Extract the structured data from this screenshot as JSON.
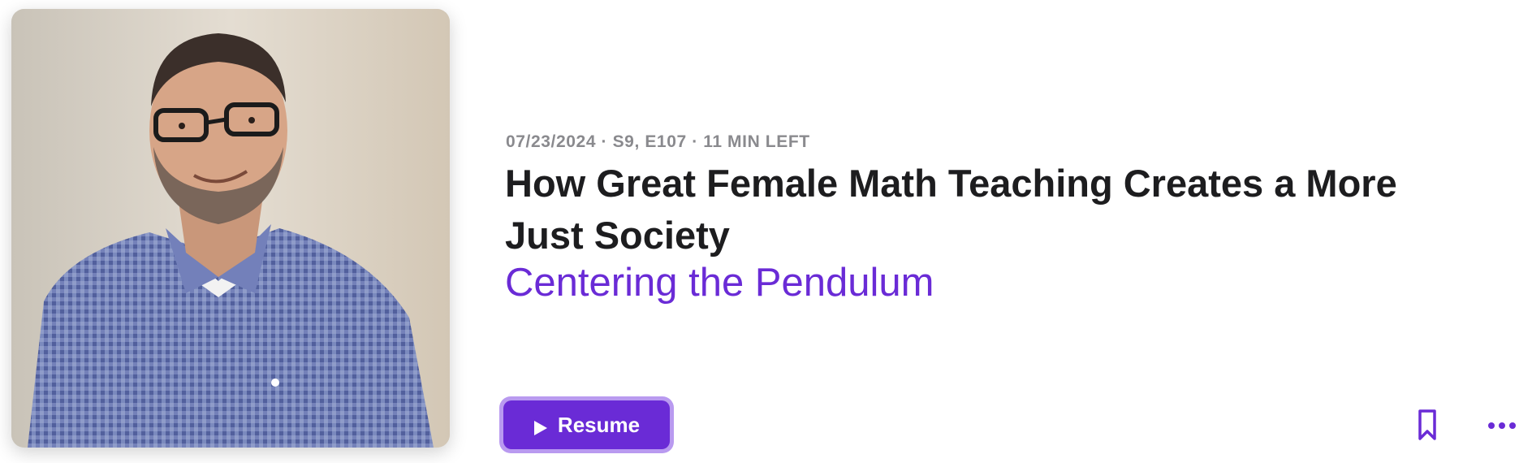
{
  "episode": {
    "meta": "07/23/2024 · S9, E107 · 11 MIN LEFT",
    "title": "How Great Female Math Teaching Creates a More Just Society",
    "show_name": "Centering the Pendulum",
    "artwork_alt": "Episode artwork"
  },
  "actions": {
    "resume_label": "Resume",
    "resume_icon": "play-icon",
    "bookmark_icon": "bookmark-icon",
    "more_icon": "ellipsis-icon"
  },
  "colors": {
    "accent": "#6a2bd6",
    "accent_focus_ring": "#b99af0",
    "title": "#1d1d1f",
    "meta": "#8a8a8e"
  }
}
